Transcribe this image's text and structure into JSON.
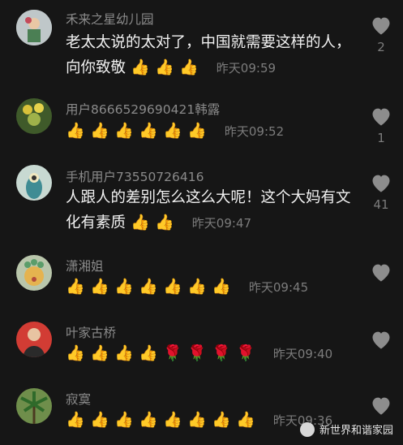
{
  "comments": [
    {
      "username": "禾来之星幼儿园",
      "text": "老太太说的太对了，中国就需要这样的人，向你致敬",
      "emoji_count": 3,
      "emoji": "👍",
      "time": "昨天09:59",
      "likes": "2",
      "avatar": "kid-icon"
    },
    {
      "username": "用户8666529690421韩露",
      "text": "",
      "emoji_count": 6,
      "emoji": "👍",
      "time": "昨天09:52",
      "likes": "1",
      "avatar": "flower-icon"
    },
    {
      "username": "手机用户73550726416",
      "text": "人跟人的差别怎么这么大呢！这个大妈有文化有素质",
      "emoji_count": 2,
      "emoji": "👍",
      "time": "昨天09:47",
      "likes": "41",
      "avatar": "alien-icon"
    },
    {
      "username": "潇湘姐",
      "text": "",
      "emoji_count": 7,
      "emoji": "👍",
      "time": "昨天09:45",
      "likes": "",
      "avatar": "monster-icon"
    },
    {
      "username": "叶家古桥",
      "text": "",
      "emoji_count": 4,
      "emoji": "👍",
      "rose_count": 4,
      "time": "昨天09:40",
      "likes": "",
      "avatar": "man-icon"
    },
    {
      "username": "寂寞",
      "text": "",
      "emoji_count": 8,
      "emoji": "👍",
      "time": "昨天09:36",
      "likes": "",
      "avatar": "palm-icon"
    }
  ],
  "watermark": "新世界和谐家园",
  "colors": {
    "background": "#161616",
    "username": "#8a8a8a",
    "time": "#7c7c7c"
  }
}
